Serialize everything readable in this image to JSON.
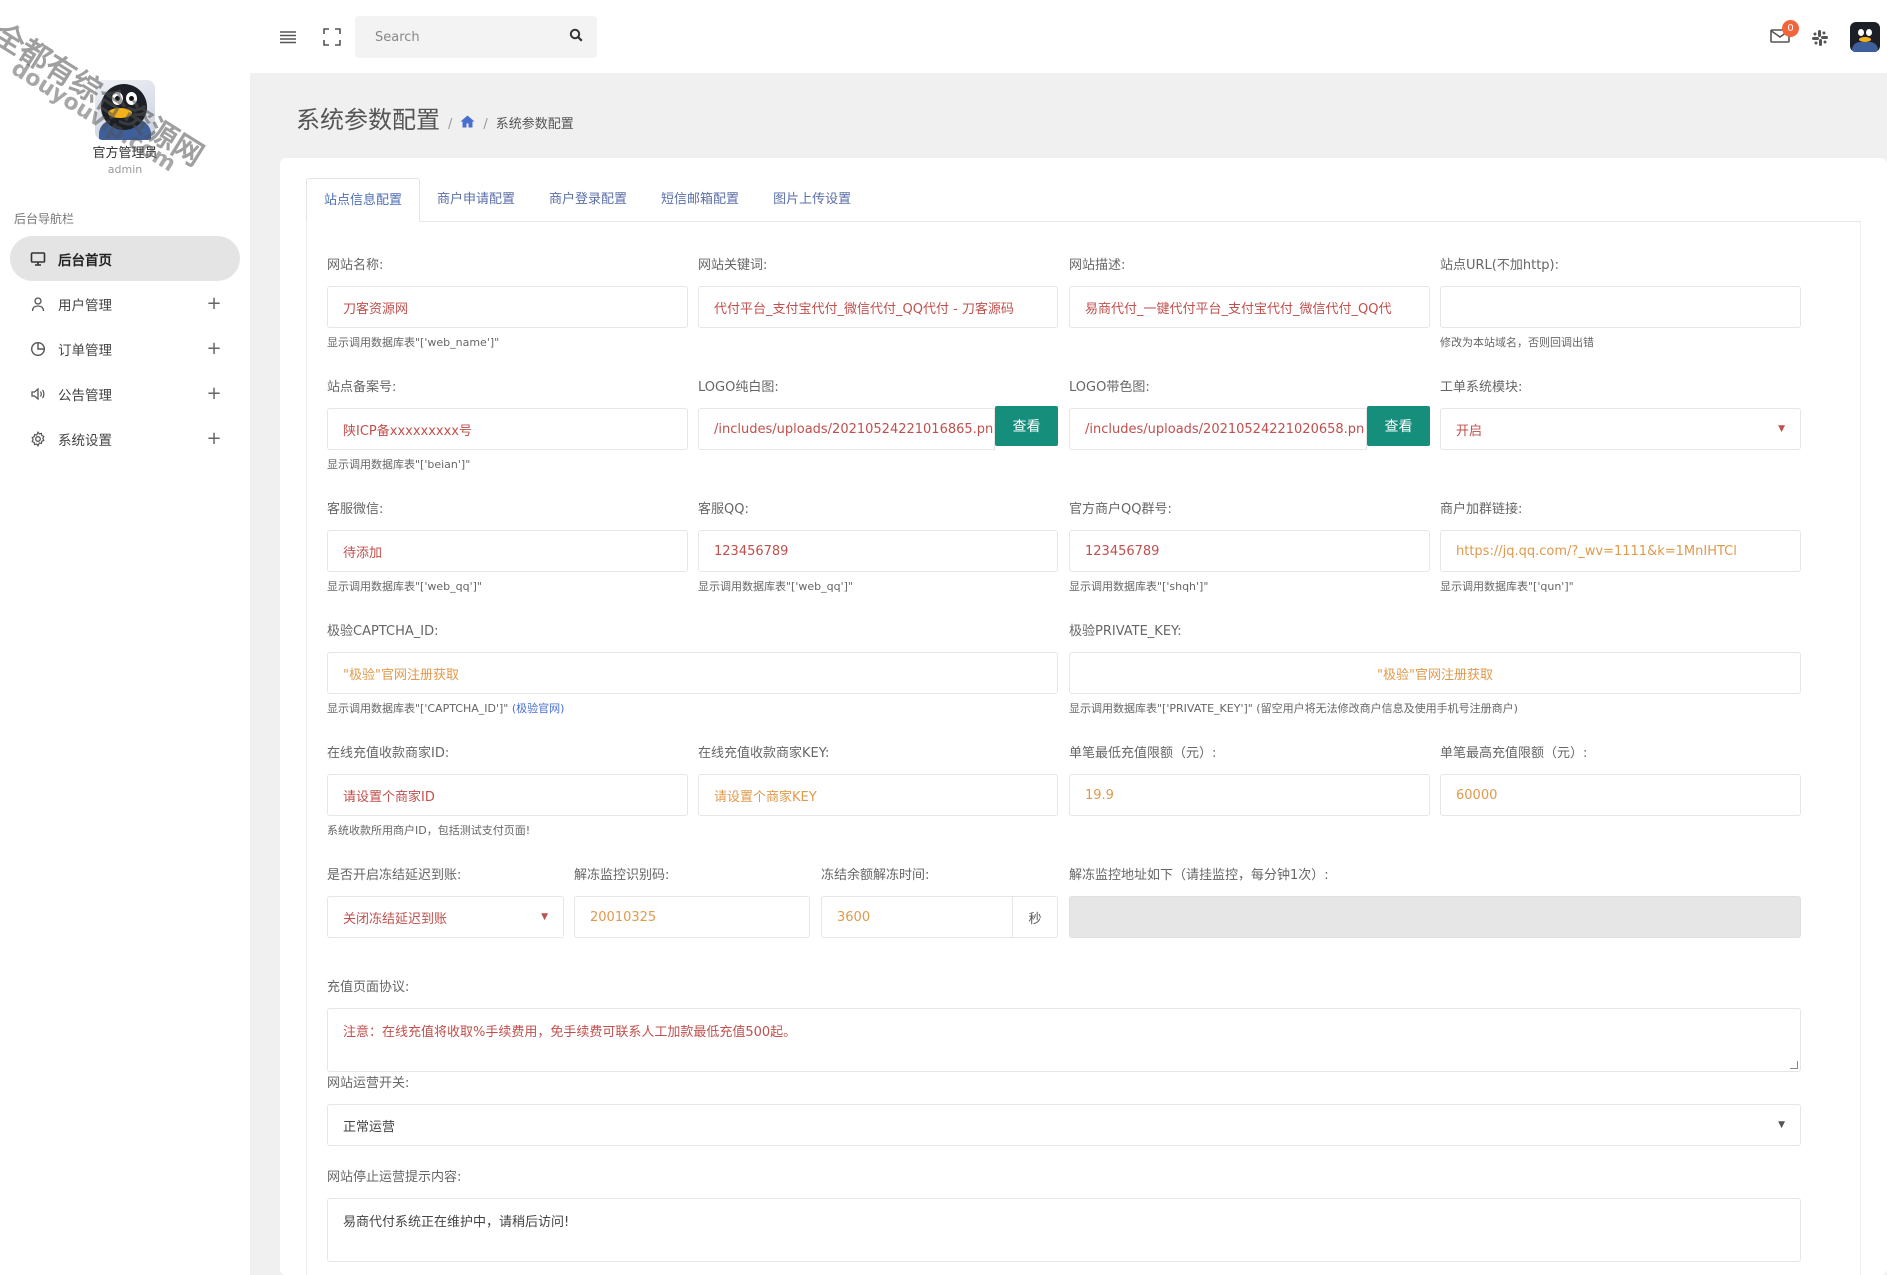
{
  "watermark": {
    "line1": "全都有综合资源网",
    "line2": "douyouvip.com"
  },
  "sidebar": {
    "profile_name": "官方管理员",
    "profile_role": "admin",
    "nav_heading": "后台导航栏",
    "items": [
      {
        "label": "后台首页",
        "icon": "monitor-icon",
        "active": true
      },
      {
        "label": "用户管理",
        "icon": "user-icon",
        "expand": "+"
      },
      {
        "label": "订单管理",
        "icon": "pie-chart-icon",
        "expand": "+"
      },
      {
        "label": "公告管理",
        "icon": "speaker-icon",
        "expand": "+"
      },
      {
        "label": "系统设置",
        "icon": "gear-icon",
        "expand": "+"
      }
    ]
  },
  "topbar": {
    "search_placeholder": "Search",
    "mail_badge": "0"
  },
  "page": {
    "title": "系统参数配置",
    "breadcrumb_sep": "/",
    "breadcrumb_current": "系统参数配置"
  },
  "tabs": [
    {
      "label": "站点信息配置",
      "active": true
    },
    {
      "label": "商户申请配置"
    },
    {
      "label": "商户登录配置"
    },
    {
      "label": "短信邮箱配置"
    },
    {
      "label": "图片上传设置"
    }
  ],
  "form": {
    "web_name": {
      "label": "网站名称:",
      "value": "刀客资源网",
      "help": "显示调用数据库表\"['web_name']\""
    },
    "keywords": {
      "label": "网站关键词:",
      "value": "代付平台_支付宝代付_微信代付_QQ代付 - 刀客源码"
    },
    "description": {
      "label": "网站描述:",
      "value": "易商代付_一键代付平台_支付宝代付_微信代付_QQ代"
    },
    "site_url": {
      "label": "站点URL(不加http):",
      "value": "",
      "help": "修改为本站域名，否则回调出错"
    },
    "beian": {
      "label": "站点备案号:",
      "value": "陕ICP备xxxxxxxxx号",
      "help": "显示调用数据库表\"['beian']\""
    },
    "logo_white": {
      "label": "LOGO纯白图:",
      "value": "/includes/uploads/20210524221016865.pn",
      "button": "查看"
    },
    "logo_color": {
      "label": "LOGO带色图:",
      "value": "/includes/uploads/20210524221020658.pn",
      "button": "查看"
    },
    "ticket_module": {
      "label": "工单系统模块:",
      "value": "开启"
    },
    "wechat": {
      "label": "客服微信:",
      "value": "待添加",
      "help": "显示调用数据库表\"['web_qq']\""
    },
    "qq": {
      "label": "客服QQ:",
      "value": "123456789",
      "help": "显示调用数据库表\"['web_qq']\""
    },
    "qq_group": {
      "label": "官方商户QQ群号:",
      "value": "123456789",
      "help": "显示调用数据库表\"['shqh']\""
    },
    "group_link": {
      "label": "商户加群链接:",
      "value": "https://jq.qq.com/?_wv=1111&k=1MnIHTCl",
      "help": "显示调用数据库表\"['qun']\""
    },
    "captcha_id": {
      "label": "极验CAPTCHA_ID:",
      "value": "\"极验\"官网注册获取",
      "help": "显示调用数据库表\"['CAPTCHA_ID']\"",
      "help_link": "(极验官网)"
    },
    "private_key": {
      "label": "极验PRIVATE_KEY:",
      "value": "\"极验\"官网注册获取",
      "help": "显示调用数据库表\"['PRIVATE_KEY']\"  (留空用户将无法修改商户信息及使用手机号注册商户)"
    },
    "merchant_id": {
      "label": "在线充值收款商家ID:",
      "value": "请设置个商家ID",
      "help": "系统收款所用商户ID，包括测试支付页面!"
    },
    "merchant_key": {
      "label": "在线充值收款商家KEY:",
      "value": "请设置个商家KEY"
    },
    "min_recharge": {
      "label": "单笔最低充值限额（元）:",
      "value": "19.9"
    },
    "max_recharge": {
      "label": "单笔最高充值限额（元）:",
      "value": "60000"
    },
    "freeze_delay": {
      "label": "是否开启冻结延迟到账:",
      "value": "关闭冻结延迟到账"
    },
    "unfreeze_code": {
      "label": "解冻监控识别码:",
      "value": "20010325"
    },
    "unfreeze_time": {
      "label": "冻结余额解冻时间:",
      "value": "3600",
      "suffix": "秒"
    },
    "unfreeze_url": {
      "label": "解冻监控地址如下（请挂监控，每分钟1次）:",
      "value": ""
    },
    "recharge_agreement": {
      "label": "充值页面协议:",
      "value": "注意：在线充值将收取%手续费用，免手续费可联系人工加款最低充值500起。"
    },
    "site_switch": {
      "label": "网站运营开关:",
      "value": "正常运营"
    },
    "stop_notice": {
      "label": "网站停止运营提示内容:",
      "value": "易商代付系统正在维护中，请稍后访问!"
    }
  },
  "colors": {
    "accent": "#168e7c",
    "value_red": "#c0504d",
    "value_orange": "#e09a4c",
    "tab_text": "#5b6fa8",
    "badge": "#f2643a"
  }
}
